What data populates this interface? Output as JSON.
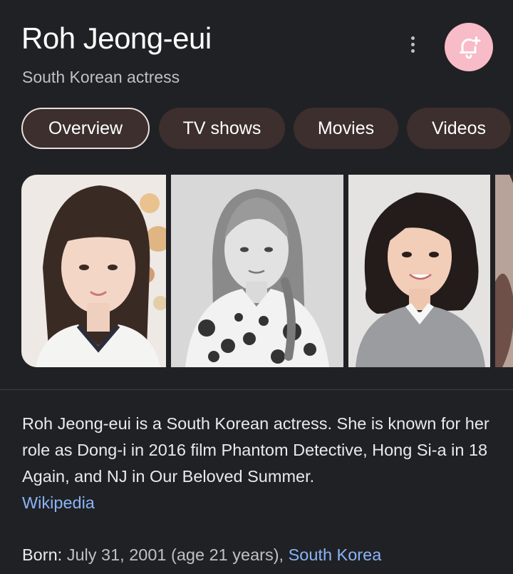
{
  "header": {
    "title": "Roh Jeong-eui",
    "subtitle": "South Korean actress"
  },
  "icons": {
    "more": "more-vert-icon",
    "bell": "notification-add-icon",
    "bell_bg": "#f8bbc8"
  },
  "tabs": [
    {
      "label": "Overview",
      "active": true
    },
    {
      "label": "TV shows",
      "active": false
    },
    {
      "label": "Movies",
      "active": false
    },
    {
      "label": "Videos",
      "active": false
    }
  ],
  "description": {
    "text": "Roh Jeong-eui is a South Korean actress. She is known for her role as Dong-i in 2016 film Phantom Detective, Hong Si-a in 18 Again, and NJ in Our Beloved Summer.",
    "source_link": "Wikipedia"
  },
  "born": {
    "label": "Born:",
    "value": " July 31, 2001 (age 21 years), ",
    "place": "South Korea"
  },
  "colors": {
    "background": "#202124",
    "chip": "#3c2f2d",
    "link": "#8ab4f8"
  }
}
